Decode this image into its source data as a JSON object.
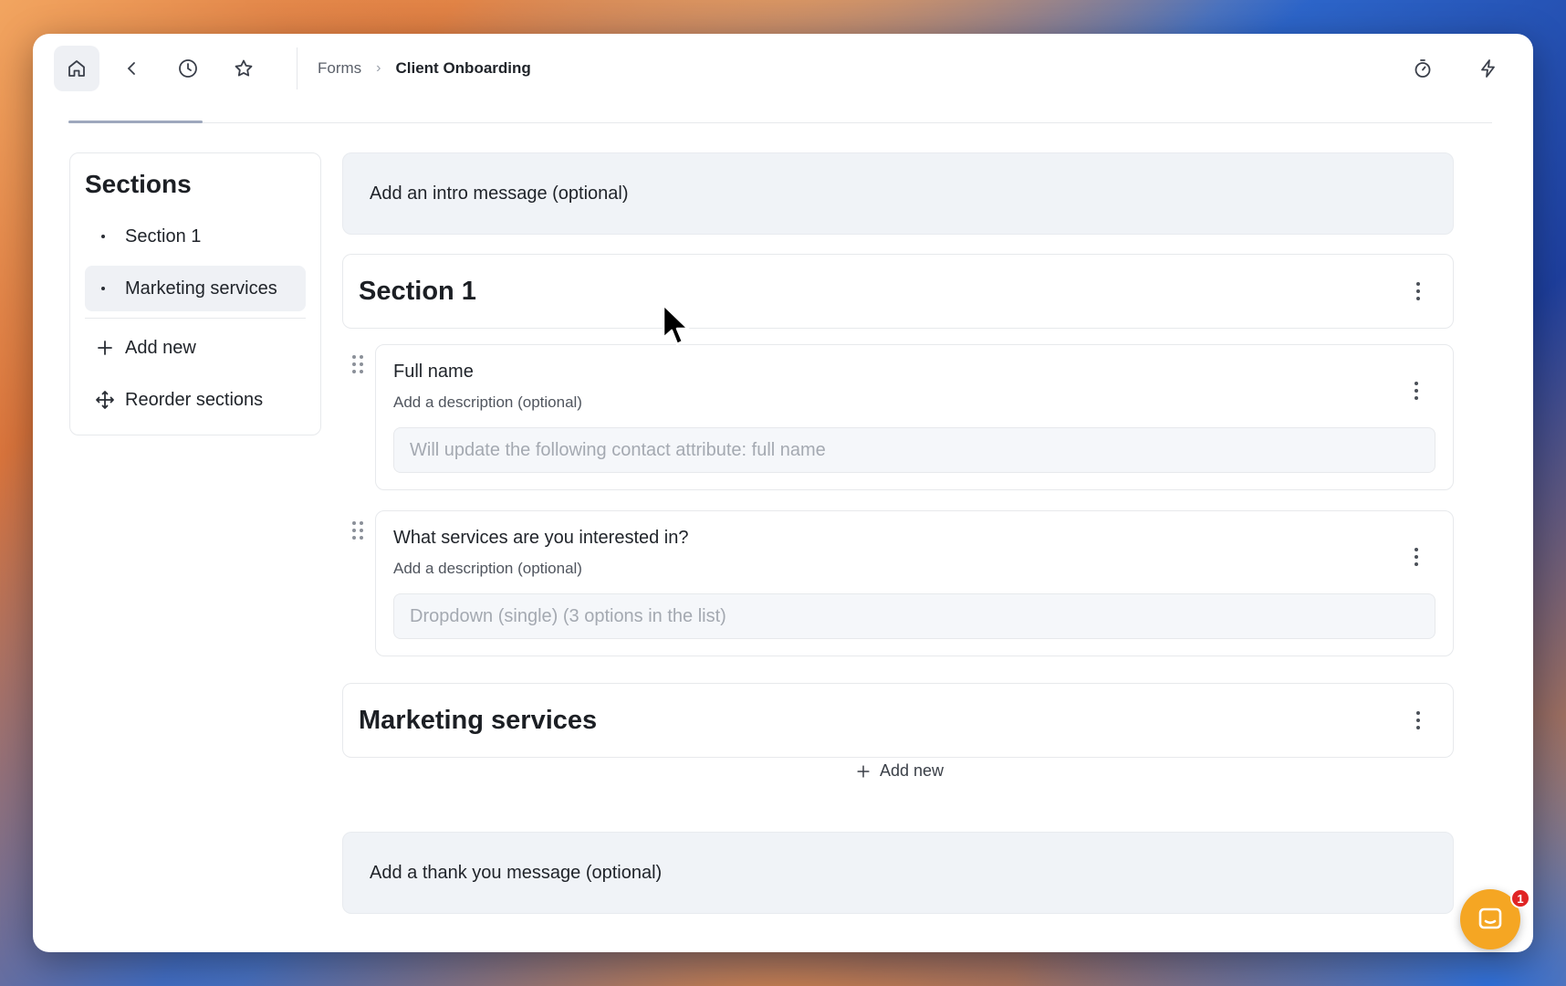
{
  "header": {
    "breadcrumb": [
      "Forms",
      "Client Onboarding"
    ],
    "icons": [
      "home-icon",
      "back-icon",
      "history-icon",
      "star-icon",
      "timer-icon",
      "lightning-icon"
    ]
  },
  "sidebar": {
    "title": "Sections",
    "items": [
      {
        "label": "Section 1",
        "active": false
      },
      {
        "label": "Marketing services",
        "active": true
      }
    ],
    "add_new_label": "Add new",
    "reorder_label": "Reorder sections"
  },
  "main": {
    "intro_placeholder": "Add an intro message (optional)",
    "sections": [
      {
        "title": "Section 1",
        "questions": [
          {
            "title": "Full name",
            "description": "Add a description (optional)",
            "field_placeholder": "Will update the following contact attribute: full name"
          },
          {
            "title": "What services are you interested in?",
            "description": "Add a description (optional)",
            "field_placeholder": "Dropdown (single) (3 options in the list)"
          }
        ]
      },
      {
        "title": "Marketing services",
        "questions": []
      }
    ],
    "add_new_label": "Add new",
    "thank_you_placeholder": "Add a thank you message (optional)"
  },
  "chat": {
    "badge_count": "1",
    "accent": "#f5a623"
  }
}
